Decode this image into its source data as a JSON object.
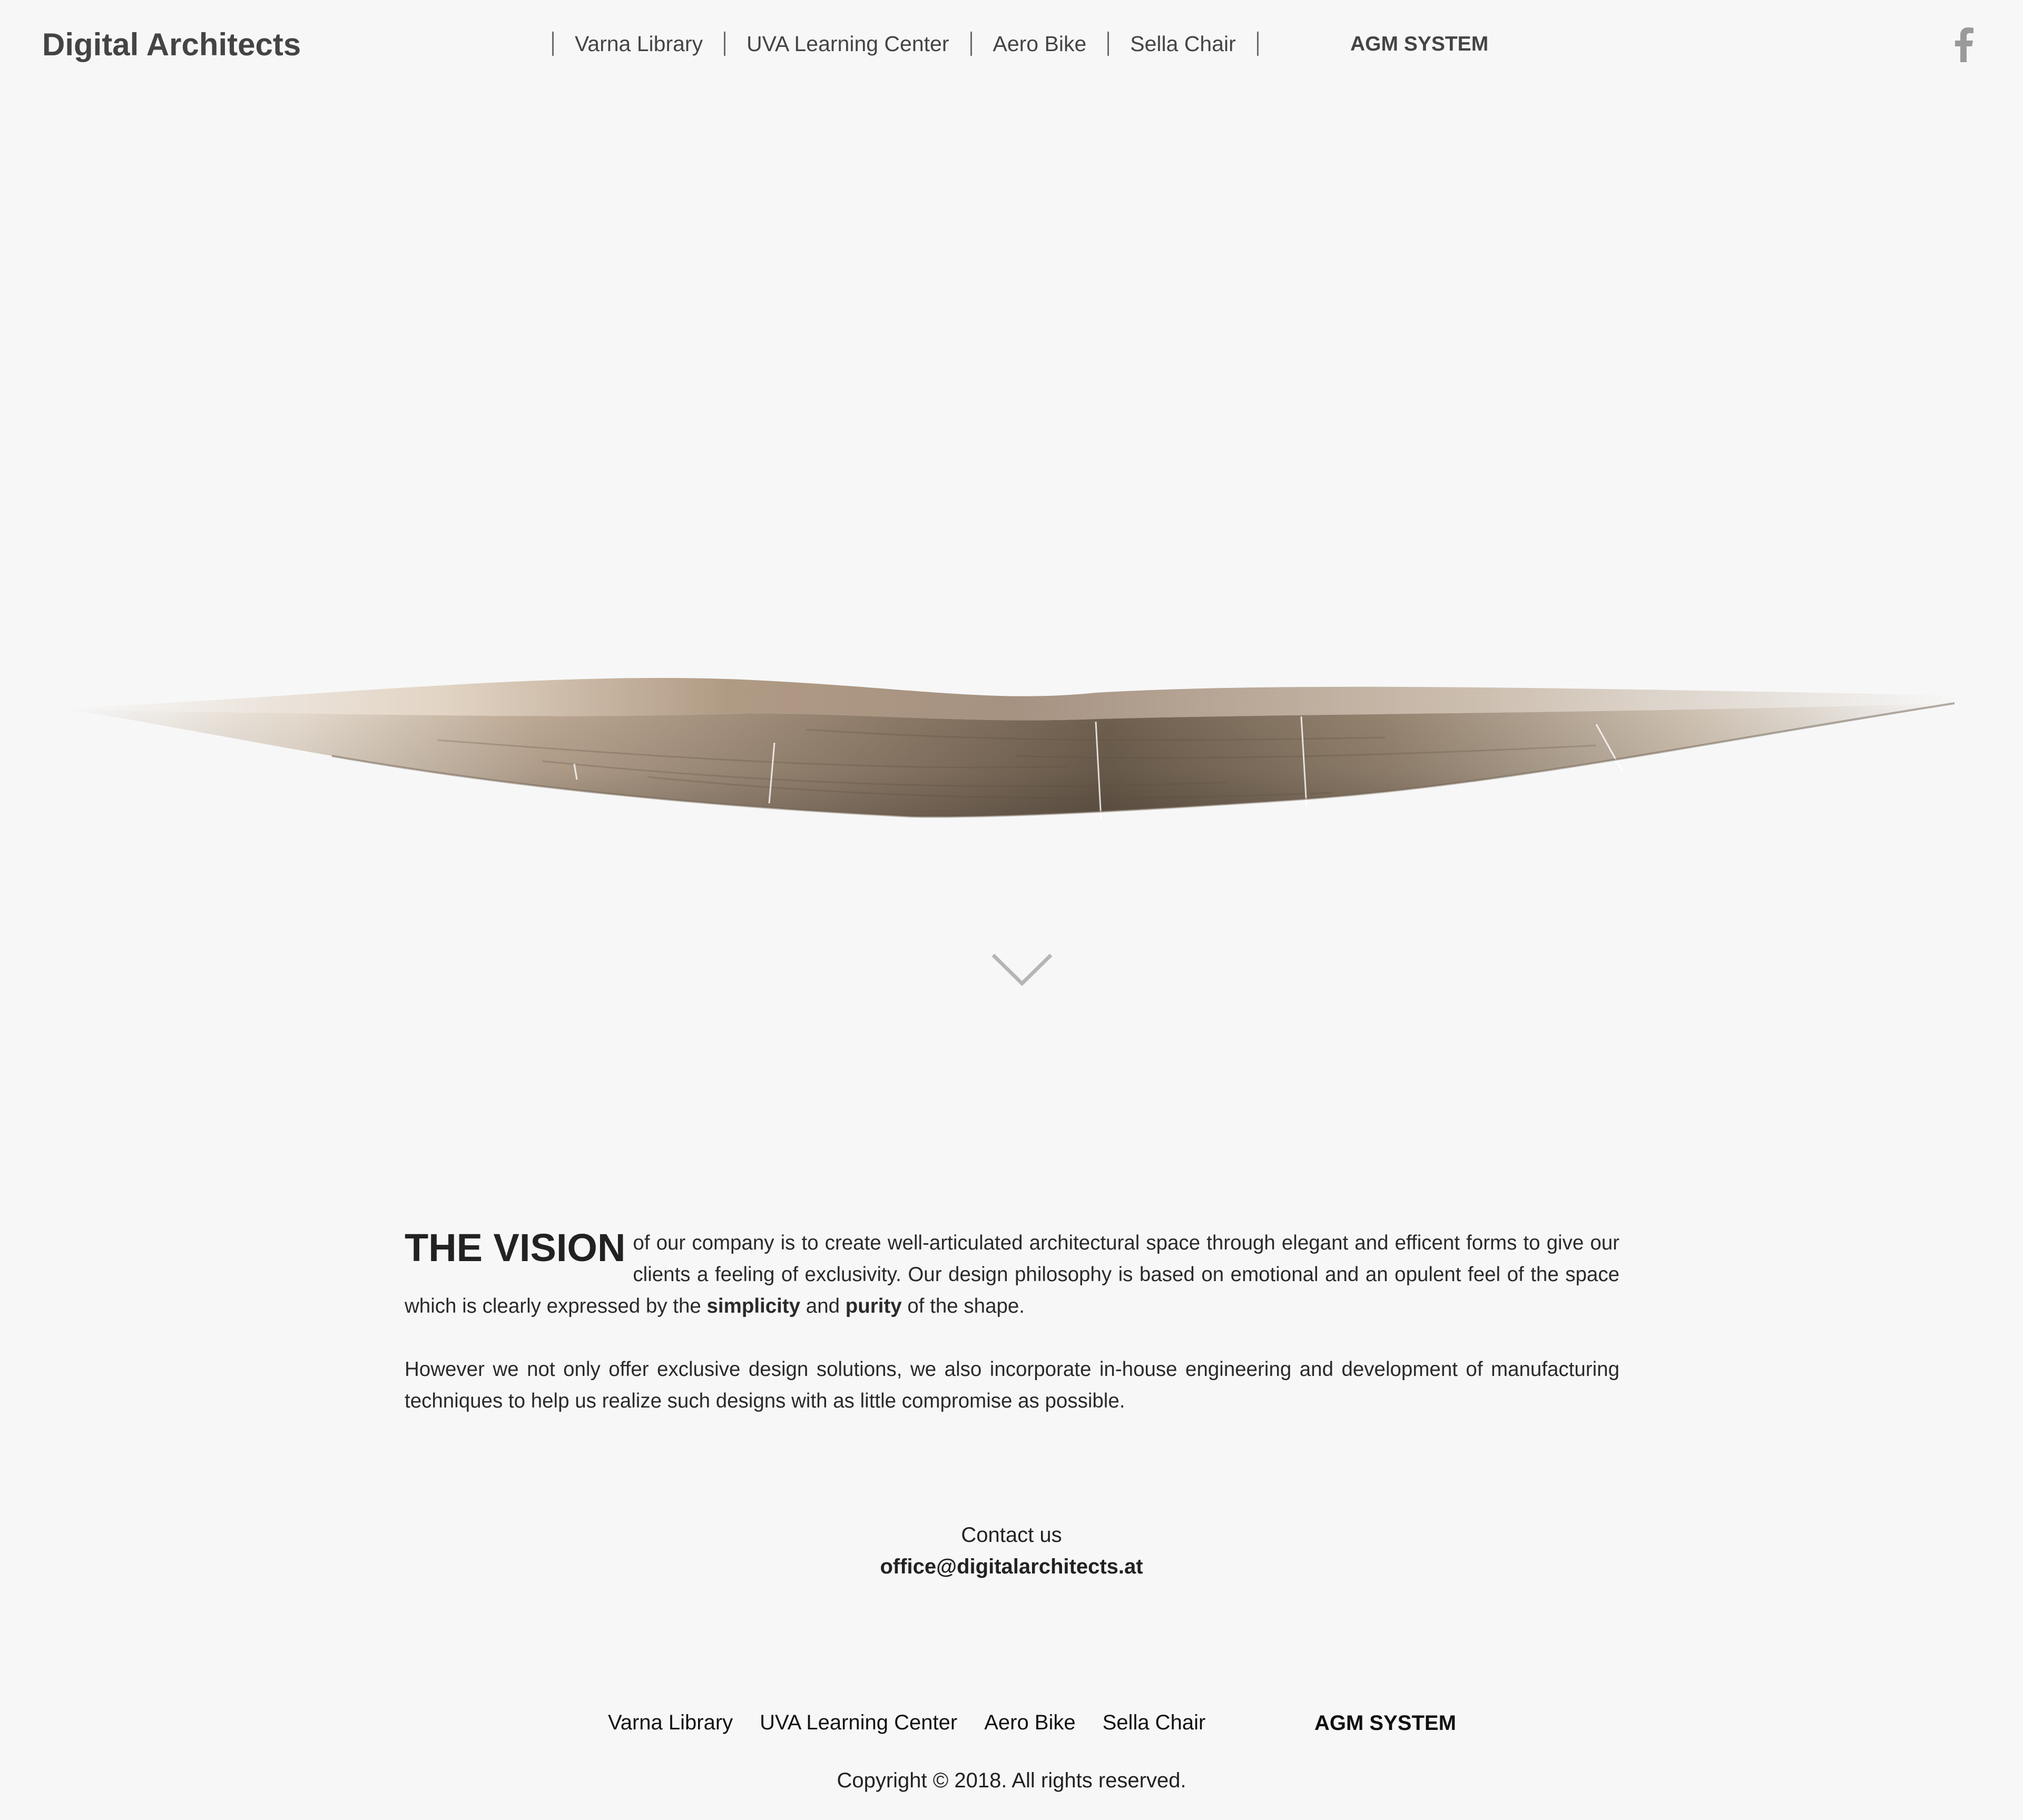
{
  "header": {
    "brand": "Digital Architects",
    "nav": [
      "Varna Library",
      "UVA Learning Center",
      "Aero Bike",
      "Sella Chair"
    ],
    "agm": "AGM SYSTEM",
    "social_icon": "facebook-icon"
  },
  "hero": {
    "image": "wooden-wave-sculpture",
    "scroll_icon": "chevron-down-icon"
  },
  "vision": {
    "title": "THE VISION",
    "p1_start": "of our company is to create well-articulated architectural space through elegant and efficent forms to give our clients a feeling of exclusivity. Our design philosophy is based on emotional and an opulent feel of the space which is clearly expressed by the",
    "bold1": "simplicity",
    "and": "and",
    "bold2": "purity",
    "p1_end": "of the shape.",
    "p2": "However we not only offer exclusive design solutions, we also incorporate in-house engineering and development of manufacturing techniques to help us realize such designs with as little compromise as possible."
  },
  "contact": {
    "label": "Contact us",
    "email": "office@digitalarchitects.at"
  },
  "footer": {
    "nav": [
      "Varna Library",
      "UVA Learning Center",
      "Aero Bike",
      "Sella Chair"
    ],
    "agm": "AGM SYSTEM",
    "copyright": "Copyright © 2018. All rights reserved."
  },
  "colors": {
    "background": "#f7f7f7",
    "text": "#222222",
    "header_text": "#444444",
    "wood": "#8a735e"
  }
}
